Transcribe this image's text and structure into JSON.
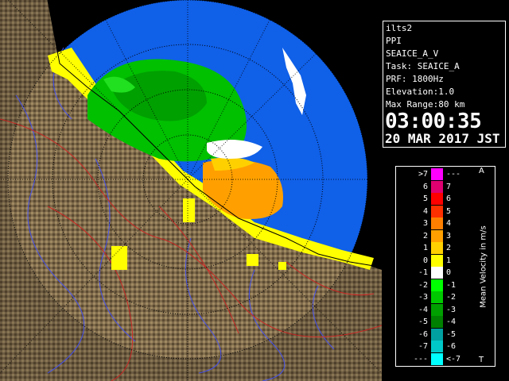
{
  "info": {
    "radar_name": "ilts2",
    "product": "PPI",
    "field": "SEAICE_A_V",
    "task": "Task: SEAICE_A",
    "prf": "PRF: 1800Hz",
    "elevation": "Elevation:1.0",
    "max_range": "Max Range:80 km",
    "time": "03:00:35",
    "date": "20 MAR 2017 JST"
  },
  "scale": {
    "title": "Mean Velocity in m/s",
    "top_corner": "A",
    "bottom_corner": "T",
    "rows": [
      {
        "left": ">7",
        "right": "---",
        "color": "#ff00ff"
      },
      {
        "left": "6",
        "right": "7",
        "color": "#e00070"
      },
      {
        "left": "5",
        "right": "6",
        "color": "#ff0000"
      },
      {
        "left": "4",
        "right": "5",
        "color": "#ff3000"
      },
      {
        "left": "3",
        "right": "4",
        "color": "#ff8000"
      },
      {
        "left": "2",
        "right": "3",
        "color": "#ffa000"
      },
      {
        "left": "1",
        "right": "2",
        "color": "#ffd000"
      },
      {
        "left": "0",
        "right": "1",
        "color": "#ffff00"
      },
      {
        "left": "-1",
        "right": "0",
        "color": "#ffffff"
      },
      {
        "left": "-2",
        "right": "-1",
        "color": "#00ff00"
      },
      {
        "left": "-3",
        "right": "-2",
        "color": "#00c800"
      },
      {
        "left": "-4",
        "right": "-3",
        "color": "#00a000"
      },
      {
        "left": "-5",
        "right": "-4",
        "color": "#008000"
      },
      {
        "left": "-6",
        "right": "-5",
        "color": "#00a0a0"
      },
      {
        "left": "-7",
        "right": "-6",
        "color": "#00c8c8"
      },
      {
        "left": "---",
        "right": "<-7",
        "color": "#00ffff"
      }
    ]
  },
  "colors": {
    "sea": "#1060e8",
    "land": "#7a6a4a",
    "background": "#000000"
  }
}
